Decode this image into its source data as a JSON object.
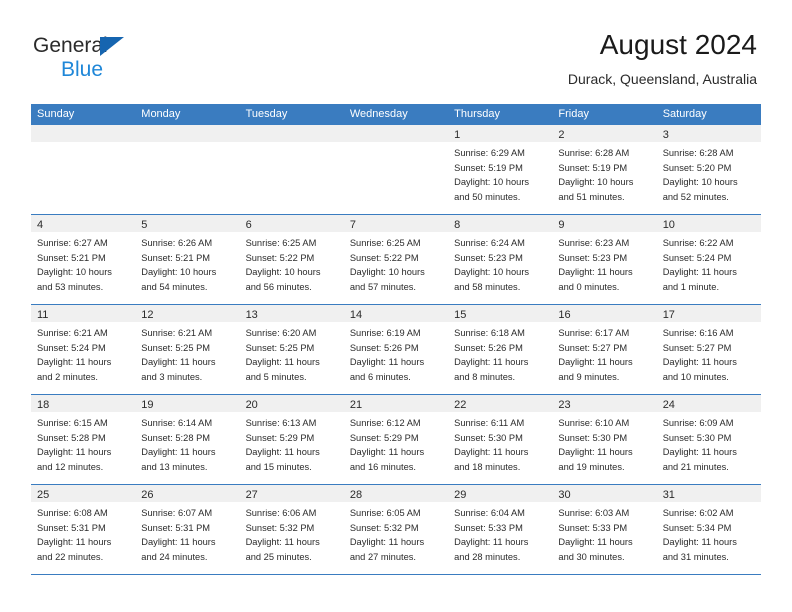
{
  "brand": {
    "name_part1": "General",
    "name_part2": "Blue",
    "logo_icon": "triangle-logo-icon"
  },
  "header": {
    "title": "August 2024",
    "location": "Durack, Queensland, Australia"
  },
  "colors": {
    "header_blue": "#3a7cc0",
    "brand_blue": "#1f87d8",
    "logo_blue": "#1665b0",
    "day_band_gray": "#f0f0f0",
    "text": "#2b2b2b"
  },
  "weekdays": [
    "Sunday",
    "Monday",
    "Tuesday",
    "Wednesday",
    "Thursday",
    "Friday",
    "Saturday"
  ],
  "weeks": [
    [
      {
        "day": "",
        "lines": []
      },
      {
        "day": "",
        "lines": []
      },
      {
        "day": "",
        "lines": []
      },
      {
        "day": "",
        "lines": []
      },
      {
        "day": "1",
        "lines": [
          "Sunrise: 6:29 AM",
          "Sunset: 5:19 PM",
          "Daylight: 10 hours",
          "and 50 minutes."
        ]
      },
      {
        "day": "2",
        "lines": [
          "Sunrise: 6:28 AM",
          "Sunset: 5:19 PM",
          "Daylight: 10 hours",
          "and 51 minutes."
        ]
      },
      {
        "day": "3",
        "lines": [
          "Sunrise: 6:28 AM",
          "Sunset: 5:20 PM",
          "Daylight: 10 hours",
          "and 52 minutes."
        ]
      }
    ],
    [
      {
        "day": "4",
        "lines": [
          "Sunrise: 6:27 AM",
          "Sunset: 5:21 PM",
          "Daylight: 10 hours",
          "and 53 minutes."
        ]
      },
      {
        "day": "5",
        "lines": [
          "Sunrise: 6:26 AM",
          "Sunset: 5:21 PM",
          "Daylight: 10 hours",
          "and 54 minutes."
        ]
      },
      {
        "day": "6",
        "lines": [
          "Sunrise: 6:25 AM",
          "Sunset: 5:22 PM",
          "Daylight: 10 hours",
          "and 56 minutes."
        ]
      },
      {
        "day": "7",
        "lines": [
          "Sunrise: 6:25 AM",
          "Sunset: 5:22 PM",
          "Daylight: 10 hours",
          "and 57 minutes."
        ]
      },
      {
        "day": "8",
        "lines": [
          "Sunrise: 6:24 AM",
          "Sunset: 5:23 PM",
          "Daylight: 10 hours",
          "and 58 minutes."
        ]
      },
      {
        "day": "9",
        "lines": [
          "Sunrise: 6:23 AM",
          "Sunset: 5:23 PM",
          "Daylight: 11 hours",
          "and 0 minutes."
        ]
      },
      {
        "day": "10",
        "lines": [
          "Sunrise: 6:22 AM",
          "Sunset: 5:24 PM",
          "Daylight: 11 hours",
          "and 1 minute."
        ]
      }
    ],
    [
      {
        "day": "11",
        "lines": [
          "Sunrise: 6:21 AM",
          "Sunset: 5:24 PM",
          "Daylight: 11 hours",
          "and 2 minutes."
        ]
      },
      {
        "day": "12",
        "lines": [
          "Sunrise: 6:21 AM",
          "Sunset: 5:25 PM",
          "Daylight: 11 hours",
          "and 3 minutes."
        ]
      },
      {
        "day": "13",
        "lines": [
          "Sunrise: 6:20 AM",
          "Sunset: 5:25 PM",
          "Daylight: 11 hours",
          "and 5 minutes."
        ]
      },
      {
        "day": "14",
        "lines": [
          "Sunrise: 6:19 AM",
          "Sunset: 5:26 PM",
          "Daylight: 11 hours",
          "and 6 minutes."
        ]
      },
      {
        "day": "15",
        "lines": [
          "Sunrise: 6:18 AM",
          "Sunset: 5:26 PM",
          "Daylight: 11 hours",
          "and 8 minutes."
        ]
      },
      {
        "day": "16",
        "lines": [
          "Sunrise: 6:17 AM",
          "Sunset: 5:27 PM",
          "Daylight: 11 hours",
          "and 9 minutes."
        ]
      },
      {
        "day": "17",
        "lines": [
          "Sunrise: 6:16 AM",
          "Sunset: 5:27 PM",
          "Daylight: 11 hours",
          "and 10 minutes."
        ]
      }
    ],
    [
      {
        "day": "18",
        "lines": [
          "Sunrise: 6:15 AM",
          "Sunset: 5:28 PM",
          "Daylight: 11 hours",
          "and 12 minutes."
        ]
      },
      {
        "day": "19",
        "lines": [
          "Sunrise: 6:14 AM",
          "Sunset: 5:28 PM",
          "Daylight: 11 hours",
          "and 13 minutes."
        ]
      },
      {
        "day": "20",
        "lines": [
          "Sunrise: 6:13 AM",
          "Sunset: 5:29 PM",
          "Daylight: 11 hours",
          "and 15 minutes."
        ]
      },
      {
        "day": "21",
        "lines": [
          "Sunrise: 6:12 AM",
          "Sunset: 5:29 PM",
          "Daylight: 11 hours",
          "and 16 minutes."
        ]
      },
      {
        "day": "22",
        "lines": [
          "Sunrise: 6:11 AM",
          "Sunset: 5:30 PM",
          "Daylight: 11 hours",
          "and 18 minutes."
        ]
      },
      {
        "day": "23",
        "lines": [
          "Sunrise: 6:10 AM",
          "Sunset: 5:30 PM",
          "Daylight: 11 hours",
          "and 19 minutes."
        ]
      },
      {
        "day": "24",
        "lines": [
          "Sunrise: 6:09 AM",
          "Sunset: 5:30 PM",
          "Daylight: 11 hours",
          "and 21 minutes."
        ]
      }
    ],
    [
      {
        "day": "25",
        "lines": [
          "Sunrise: 6:08 AM",
          "Sunset: 5:31 PM",
          "Daylight: 11 hours",
          "and 22 minutes."
        ]
      },
      {
        "day": "26",
        "lines": [
          "Sunrise: 6:07 AM",
          "Sunset: 5:31 PM",
          "Daylight: 11 hours",
          "and 24 minutes."
        ]
      },
      {
        "day": "27",
        "lines": [
          "Sunrise: 6:06 AM",
          "Sunset: 5:32 PM",
          "Daylight: 11 hours",
          "and 25 minutes."
        ]
      },
      {
        "day": "28",
        "lines": [
          "Sunrise: 6:05 AM",
          "Sunset: 5:32 PM",
          "Daylight: 11 hours",
          "and 27 minutes."
        ]
      },
      {
        "day": "29",
        "lines": [
          "Sunrise: 6:04 AM",
          "Sunset: 5:33 PM",
          "Daylight: 11 hours",
          "and 28 minutes."
        ]
      },
      {
        "day": "30",
        "lines": [
          "Sunrise: 6:03 AM",
          "Sunset: 5:33 PM",
          "Daylight: 11 hours",
          "and 30 minutes."
        ]
      },
      {
        "day": "31",
        "lines": [
          "Sunrise: 6:02 AM",
          "Sunset: 5:34 PM",
          "Daylight: 11 hours",
          "and 31 minutes."
        ]
      }
    ]
  ]
}
